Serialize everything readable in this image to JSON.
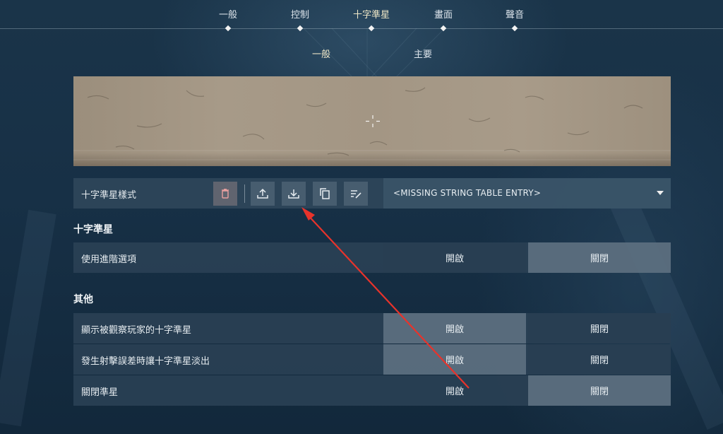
{
  "top_nav": {
    "tabs": [
      {
        "label": "一般",
        "active": false
      },
      {
        "label": "控制",
        "active": false
      },
      {
        "label": "十字準星",
        "active": true
      },
      {
        "label": "畫面",
        "active": false
      },
      {
        "label": "聲音",
        "active": false
      }
    ]
  },
  "sub_nav": {
    "tabs": [
      {
        "label": "一般",
        "active": true
      },
      {
        "label": "主要",
        "active": false
      }
    ]
  },
  "crosshair_style": {
    "label": "十字準星樣式",
    "selected_value": "<MISSING STRING TABLE ENTRY>",
    "tool_icons": [
      "trash-icon",
      "upload-icon",
      "download-icon",
      "copy-icon",
      "rename-icon"
    ]
  },
  "sections": [
    {
      "title": "十字準星",
      "rows": [
        {
          "label": "使用進階選項",
          "on_label": "開啟",
          "off_label": "關閉",
          "value": "off"
        }
      ]
    },
    {
      "title": "其他",
      "rows": [
        {
          "label": "顯示被觀察玩家的十字準星",
          "on_label": "開啟",
          "off_label": "關閉",
          "value": "on"
        },
        {
          "label": "發生射擊誤差時讓十字準星淡出",
          "on_label": "開啟",
          "off_label": "關閉",
          "value": "on"
        },
        {
          "label": "關閉準星",
          "on_label": "開啟",
          "off_label": "關閉",
          "value": "off"
        }
      ]
    }
  ],
  "colors": {
    "annotation_arrow": "#e8332b",
    "active_tab": "#f0e8c8"
  }
}
